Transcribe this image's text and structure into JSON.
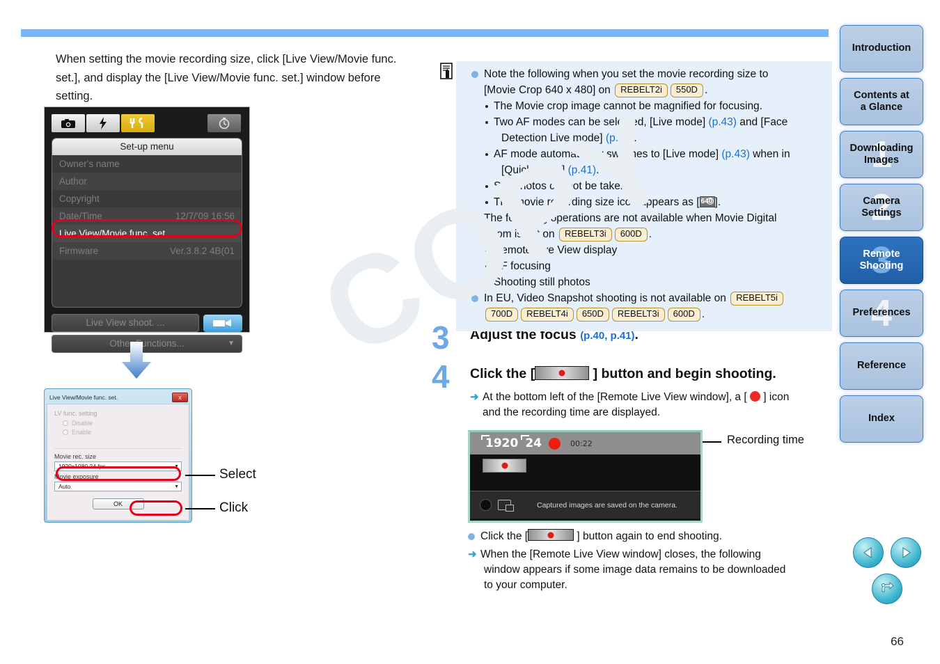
{
  "page": {
    "number": "66",
    "watermark": "COPY"
  },
  "left": {
    "intro": "When setting the movie recording size, click [Live View/Movie func. set.], and display the [Live View/Movie func. set.] window before setting.",
    "camera_menu": {
      "tabs": [
        "camera-icon",
        "flash-icon",
        "wrench-tools-icon",
        "timer-icon"
      ],
      "title": "Set-up menu",
      "rows": [
        {
          "label": "Owner's name",
          "value": ""
        },
        {
          "label": "Author",
          "value": ""
        },
        {
          "label": "Copyright",
          "value": ""
        },
        {
          "label": "Date/Time",
          "value": "12/7/'09  16:56"
        },
        {
          "label": "Live View/Movie func. set.",
          "value": "",
          "selected": true
        },
        {
          "label": "Firmware",
          "value": "Ver.3.8.2 4B(01"
        }
      ],
      "live_view_button": "Live View shoot. ...",
      "other_functions_button": "Other Functions..."
    },
    "dialog": {
      "title": "Live View/Movie func. set.",
      "close_label": "x",
      "lv_func_label": "LV func. setting",
      "radio_disable": "Disable",
      "radio_enable": "Enable",
      "movie_rec_size_label": "Movie rec. size",
      "movie_rec_size_value": "1920x1080  24 fps",
      "movie_exposure_label": "Movie exposure",
      "movie_exposure_value": "Auto",
      "ok_label": "OK"
    },
    "callouts": {
      "select": "Select",
      "click": "Click"
    }
  },
  "note": {
    "icon": "note-pencil-icon",
    "lines": [
      {
        "type": "bullet",
        "text": "Note the following when you set the movie recording size to"
      },
      {
        "type": "cont",
        "text": "[Movie Crop 640 x 480] on",
        "badges": [
          "REBELT2i",
          "550D"
        ],
        "suffix": "."
      },
      {
        "type": "sub",
        "text": "The Movie crop image cannot be magnified for focusing."
      },
      {
        "type": "sub",
        "text": "Two AF modes can be selected, [Live mode] (p.43) and [Face"
      },
      {
        "type": "subcont",
        "text": "Detection Live mode] (p.44)."
      },
      {
        "type": "sub",
        "text": "AF mode automatically switches to [Live mode] (p.43) when in"
      },
      {
        "type": "subcont",
        "text": "[Quick mode] (p.41)."
      },
      {
        "type": "sub",
        "text": "Still photos cannot be taken."
      },
      {
        "type": "sub",
        "text": "The movie recording size icon appears as [640-icon]."
      },
      {
        "type": "bullet",
        "text": "The following operations are not available when Movie Digital"
      },
      {
        "type": "cont",
        "text": "Zoom is set on",
        "badges": [
          "REBELT3i",
          "600D"
        ],
        "suffix": "."
      },
      {
        "type": "sub",
        "text": "Remote Live View display"
      },
      {
        "type": "sub",
        "text": "AF focusing"
      },
      {
        "type": "sub",
        "text": "Shooting still photos"
      },
      {
        "type": "bullet",
        "text": "In EU, Video Snapshot shooting is not available on",
        "badges": [
          "REBELT5i"
        ]
      },
      {
        "type": "cont2",
        "badges": [
          "700D",
          "REBELT4i",
          "650D",
          "REBELT3i",
          "600D"
        ],
        "suffix": "."
      }
    ],
    "page_refs": {
      "p43": "(p.43)",
      "p44": "(p.44)",
      "p41": "(p.41)"
    }
  },
  "steps": [
    {
      "num": "3",
      "head": "Adjust the focus",
      "head_ref": "(p.40, p.41)",
      "head_suffix": "."
    },
    {
      "num": "4",
      "head_pre": "Click the [",
      "head_post": "] button and begin shooting.",
      "sub_pre": "At the bottom left of the [Remote Live View window], a [",
      "sub_post": "] icon",
      "sub_line2": "and the recording time are displayed."
    }
  ],
  "remote_live_view": {
    "resolution_tag": "1920",
    "fps_tag": "24",
    "rec_time": "00:22",
    "status_message": "Captured images are saved on the camera.",
    "callout": "Recording time"
  },
  "bottom_notes": {
    "bullet_pre": "Click the [",
    "bullet_post": "] button again to end shooting.",
    "arrow_line1": "When the [Remote Live View window] closes, the following",
    "arrow_line2": "window appears if some image data remains to be downloaded",
    "arrow_line3": "to your computer."
  },
  "sidebar": {
    "tabs": [
      {
        "label": "Introduction",
        "ghost": "",
        "active": false
      },
      {
        "label": "Contents at\na Glance",
        "ghost": "",
        "active": false
      },
      {
        "label": "Downloading\nImages",
        "ghost": "1",
        "active": false
      },
      {
        "label": "Camera\nSettings",
        "ghost": "2",
        "active": false
      },
      {
        "label": "Remote\nShooting",
        "ghost": "3",
        "active": true
      },
      {
        "label": "Preferences",
        "ghost": "4",
        "active": false
      },
      {
        "label": "Reference",
        "ghost": "",
        "active": false
      },
      {
        "label": "Index",
        "ghost": "",
        "active": false
      }
    ]
  },
  "nav": {
    "prev": "prev-arrow-icon",
    "next": "next-arrow-icon",
    "back": "return-arrow-icon"
  },
  "colors": {
    "accent_blue": "#7db4f5",
    "note_bg": "#e6f0fb",
    "link": "#1b6fd4",
    "highlight_red": "#e2001a",
    "tab_active": "#2f72bd"
  }
}
